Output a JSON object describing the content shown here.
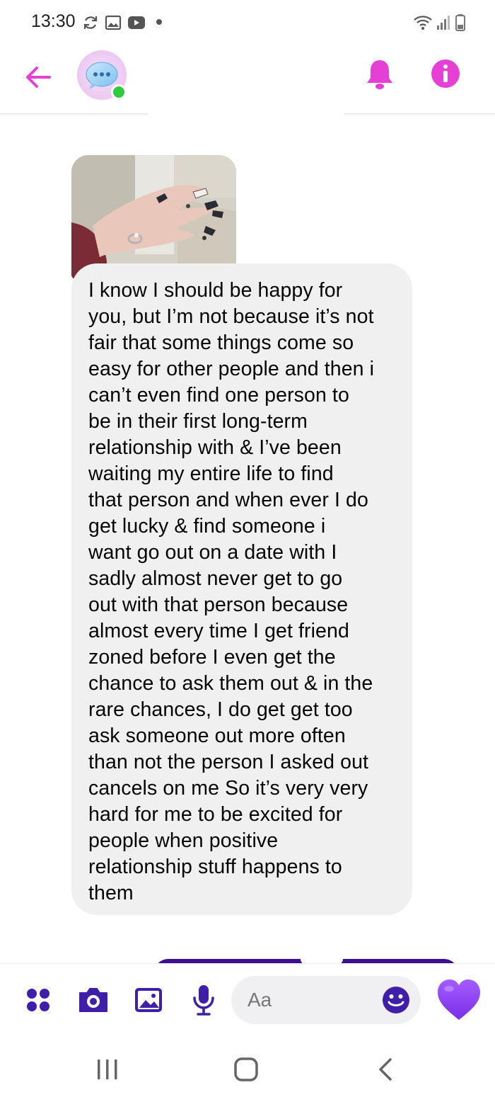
{
  "status_bar": {
    "time": "13:30",
    "icons": [
      "sync-icon",
      "gallery-icon",
      "youtube-icon",
      "dot-icon",
      "wifi-icon",
      "signal-icon",
      "battery-icon"
    ]
  },
  "header": {
    "icons": [
      "back-arrow-icon",
      "chat-avatar-icon",
      "bell-icon",
      "info-icon"
    ],
    "accent_color": "#e53fd6",
    "online_color": "#31c940"
  },
  "messages": [
    {
      "type": "image",
      "description_icon": "nail-photo"
    },
    {
      "type": "text",
      "lines": [
        "I know I should be happy for",
        "you, but I’m not because it’s not",
        "fair that some things come so",
        "easy for other people and then i",
        "can’t even find one person to",
        "be in their first long-term",
        "relationship with & I’ve been",
        "waiting my entire life to find",
        "that person and when ever I do",
        "get lucky & find someone i",
        "want go out on a date with I",
        "sadly almost never get to go",
        "out with that person because",
        "almost every time I get friend",
        "zoned before I even get the",
        "chance to ask them out & in the",
        "rare chances, I do get get too",
        "ask someone out more often",
        "than not the person I asked out",
        "cancels on me So it’s very very",
        "hard for me to be excited for",
        "people when positive",
        "relationship stuff happens to",
        "them"
      ]
    }
  ],
  "composer": {
    "placeholder": "Aa",
    "icons": [
      "menu-dots-icon",
      "camera-icon",
      "gallery-icon",
      "microphone-icon",
      "emoji-icon",
      "heart-icon"
    ],
    "icon_color": "#3f1fa8",
    "heart_color": "#8b3ff5"
  },
  "navbar": {
    "icons": [
      "recent-apps-icon",
      "home-icon",
      "back-icon"
    ]
  }
}
